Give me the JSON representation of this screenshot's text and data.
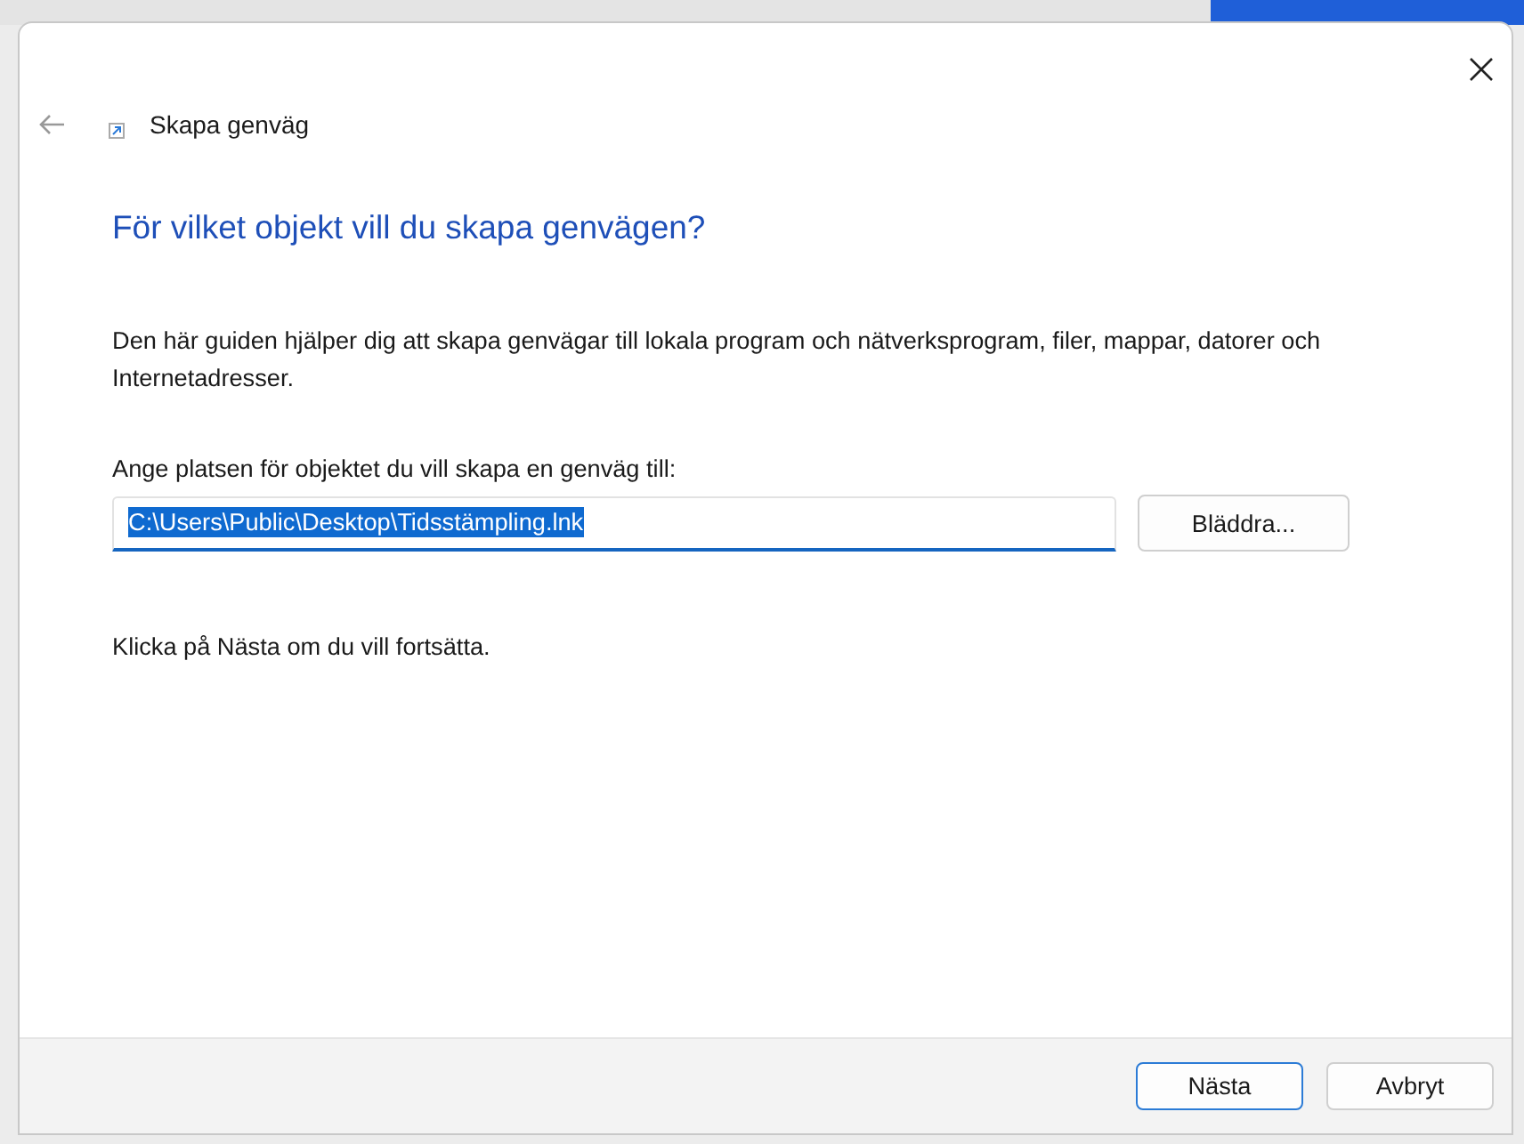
{
  "dialog": {
    "title": "Skapa genväg",
    "heading": "För vilket objekt vill du skapa genvägen?",
    "description": "Den här guiden hjälper dig att skapa genvägar till lokala program och nätverksprogram, filer, mappar, datorer och Internetadresser.",
    "field_label": "Ange platsen för objektet du vill skapa en genväg till:",
    "location": {
      "value": "C:\\Users\\Public\\Desktop\\Tidsstämpling.lnk",
      "selected": true
    },
    "browse_button": "Bläddra...",
    "hint": "Klicka på Nästa om du vill fortsätta.",
    "buttons": [
      {
        "label": "Nästa",
        "default": true
      },
      {
        "label": "Avbryt",
        "default": false
      }
    ]
  }
}
